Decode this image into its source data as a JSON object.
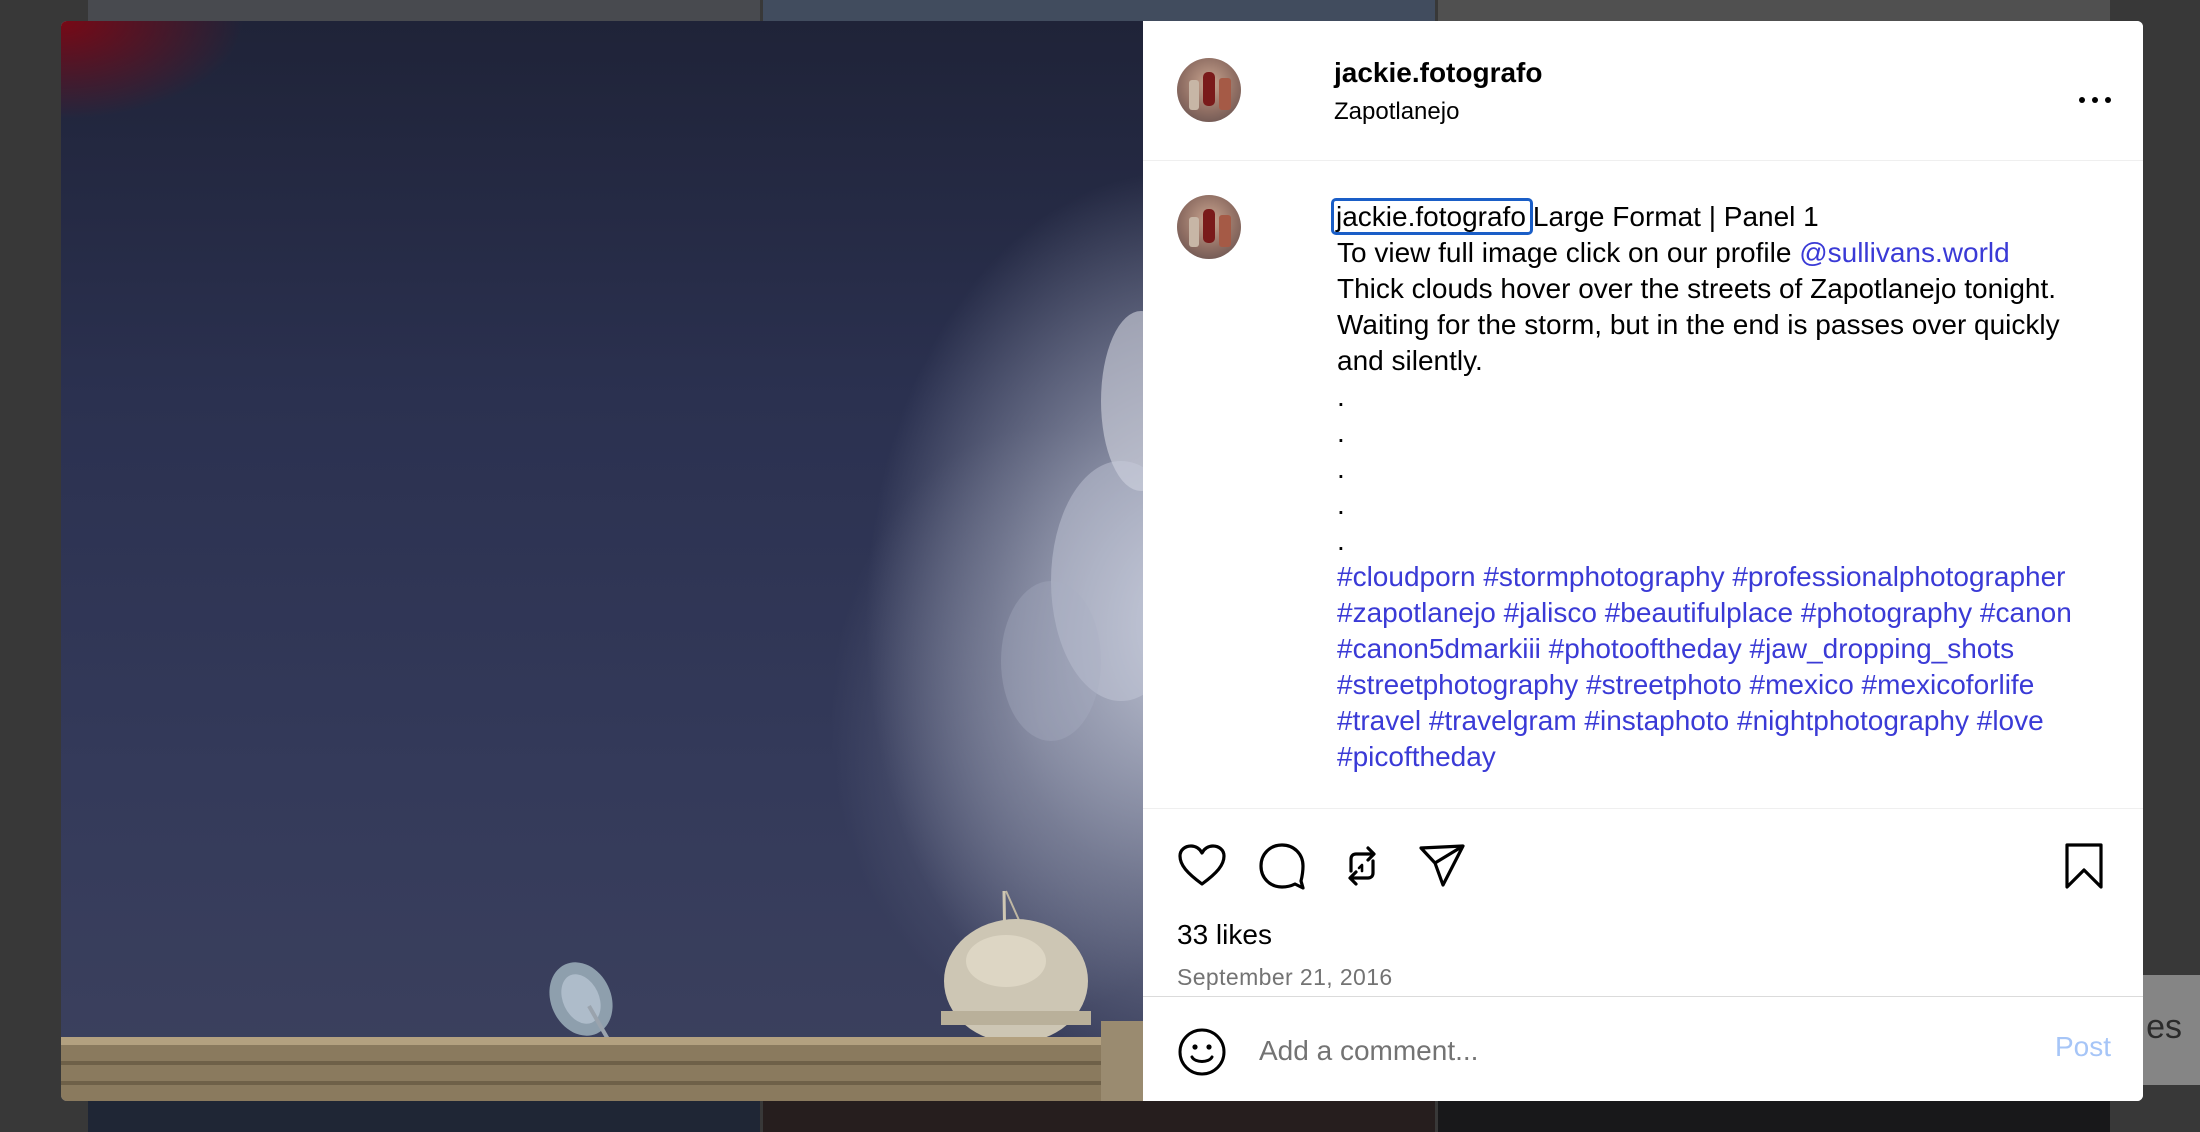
{
  "post": {
    "username": "jackie.fotografo",
    "location": "Zapotlanejo",
    "caption": {
      "author": "jackie.fotografo",
      "title": "Large Format | Panel 1",
      "line2_prefix": "To view full image click on our profile ",
      "mention": "@sullivans.world",
      "body_lines": [
        "Thick clouds hover over the streets of Zapotlanejo tonight.",
        "Waiting for the storm, but in the end is passes over quickly",
        "and silently."
      ],
      "dots": [
        ".",
        ".",
        ".",
        ".",
        "."
      ],
      "hashtags": "#cloudporn #stormphotography #professionalphotographer #zapotlanejo #jalisco #beautifulplace #photography #canon #canon5dmarkiii #photooftheday #jaw_dropping_shots #streetphotography #streetphoto #mexico #mexicoforlife #travel #travelgram #instaphoto #nightphotography #love #picoftheday"
    },
    "likes": "33 likes",
    "date": "September 21, 2016"
  },
  "actions": {
    "like_icon": "heart-icon",
    "comment_icon": "comment-icon",
    "repost_icon": "repost-icon",
    "share_icon": "share-icon",
    "save_icon": "bookmark-icon",
    "more_icon": "more-icon"
  },
  "comment": {
    "placeholder": "Add a comment...",
    "post_label": "Post"
  },
  "background": {
    "partial_text": "es"
  },
  "colors": {
    "link": "#3a3ad6",
    "post_button_disabled": "#a6c5f7",
    "focus_outline": "#1a5ec7"
  }
}
